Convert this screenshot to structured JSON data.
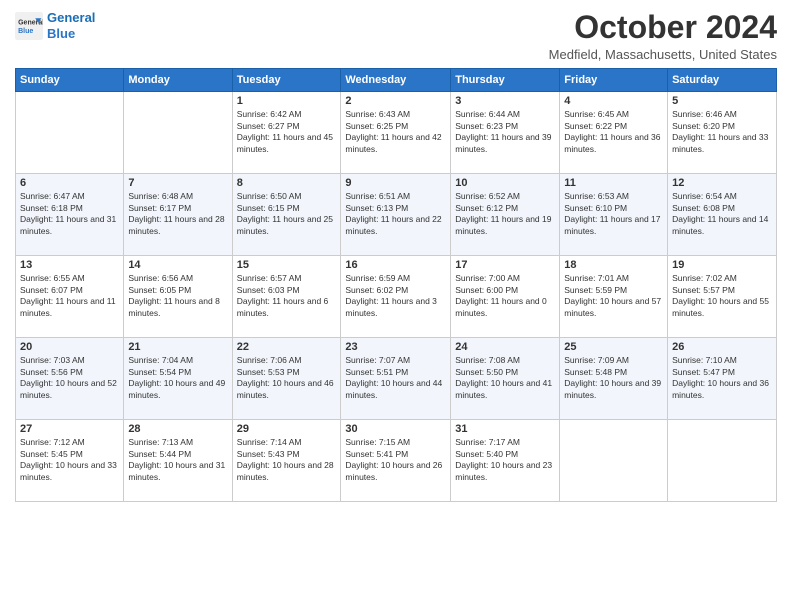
{
  "header": {
    "logo_line1": "General",
    "logo_line2": "Blue",
    "month": "October 2024",
    "location": "Medfield, Massachusetts, United States"
  },
  "weekdays": [
    "Sunday",
    "Monday",
    "Tuesday",
    "Wednesday",
    "Thursday",
    "Friday",
    "Saturday"
  ],
  "weeks": [
    [
      {
        "day": "",
        "sunrise": "",
        "sunset": "",
        "daylight": ""
      },
      {
        "day": "",
        "sunrise": "",
        "sunset": "",
        "daylight": ""
      },
      {
        "day": "1",
        "sunrise": "Sunrise: 6:42 AM",
        "sunset": "Sunset: 6:27 PM",
        "daylight": "Daylight: 11 hours and 45 minutes."
      },
      {
        "day": "2",
        "sunrise": "Sunrise: 6:43 AM",
        "sunset": "Sunset: 6:25 PM",
        "daylight": "Daylight: 11 hours and 42 minutes."
      },
      {
        "day": "3",
        "sunrise": "Sunrise: 6:44 AM",
        "sunset": "Sunset: 6:23 PM",
        "daylight": "Daylight: 11 hours and 39 minutes."
      },
      {
        "day": "4",
        "sunrise": "Sunrise: 6:45 AM",
        "sunset": "Sunset: 6:22 PM",
        "daylight": "Daylight: 11 hours and 36 minutes."
      },
      {
        "day": "5",
        "sunrise": "Sunrise: 6:46 AM",
        "sunset": "Sunset: 6:20 PM",
        "daylight": "Daylight: 11 hours and 33 minutes."
      }
    ],
    [
      {
        "day": "6",
        "sunrise": "Sunrise: 6:47 AM",
        "sunset": "Sunset: 6:18 PM",
        "daylight": "Daylight: 11 hours and 31 minutes."
      },
      {
        "day": "7",
        "sunrise": "Sunrise: 6:48 AM",
        "sunset": "Sunset: 6:17 PM",
        "daylight": "Daylight: 11 hours and 28 minutes."
      },
      {
        "day": "8",
        "sunrise": "Sunrise: 6:50 AM",
        "sunset": "Sunset: 6:15 PM",
        "daylight": "Daylight: 11 hours and 25 minutes."
      },
      {
        "day": "9",
        "sunrise": "Sunrise: 6:51 AM",
        "sunset": "Sunset: 6:13 PM",
        "daylight": "Daylight: 11 hours and 22 minutes."
      },
      {
        "day": "10",
        "sunrise": "Sunrise: 6:52 AM",
        "sunset": "Sunset: 6:12 PM",
        "daylight": "Daylight: 11 hours and 19 minutes."
      },
      {
        "day": "11",
        "sunrise": "Sunrise: 6:53 AM",
        "sunset": "Sunset: 6:10 PM",
        "daylight": "Daylight: 11 hours and 17 minutes."
      },
      {
        "day": "12",
        "sunrise": "Sunrise: 6:54 AM",
        "sunset": "Sunset: 6:08 PM",
        "daylight": "Daylight: 11 hours and 14 minutes."
      }
    ],
    [
      {
        "day": "13",
        "sunrise": "Sunrise: 6:55 AM",
        "sunset": "Sunset: 6:07 PM",
        "daylight": "Daylight: 11 hours and 11 minutes."
      },
      {
        "day": "14",
        "sunrise": "Sunrise: 6:56 AM",
        "sunset": "Sunset: 6:05 PM",
        "daylight": "Daylight: 11 hours and 8 minutes."
      },
      {
        "day": "15",
        "sunrise": "Sunrise: 6:57 AM",
        "sunset": "Sunset: 6:03 PM",
        "daylight": "Daylight: 11 hours and 6 minutes."
      },
      {
        "day": "16",
        "sunrise": "Sunrise: 6:59 AM",
        "sunset": "Sunset: 6:02 PM",
        "daylight": "Daylight: 11 hours and 3 minutes."
      },
      {
        "day": "17",
        "sunrise": "Sunrise: 7:00 AM",
        "sunset": "Sunset: 6:00 PM",
        "daylight": "Daylight: 11 hours and 0 minutes."
      },
      {
        "day": "18",
        "sunrise": "Sunrise: 7:01 AM",
        "sunset": "Sunset: 5:59 PM",
        "daylight": "Daylight: 10 hours and 57 minutes."
      },
      {
        "day": "19",
        "sunrise": "Sunrise: 7:02 AM",
        "sunset": "Sunset: 5:57 PM",
        "daylight": "Daylight: 10 hours and 55 minutes."
      }
    ],
    [
      {
        "day": "20",
        "sunrise": "Sunrise: 7:03 AM",
        "sunset": "Sunset: 5:56 PM",
        "daylight": "Daylight: 10 hours and 52 minutes."
      },
      {
        "day": "21",
        "sunrise": "Sunrise: 7:04 AM",
        "sunset": "Sunset: 5:54 PM",
        "daylight": "Daylight: 10 hours and 49 minutes."
      },
      {
        "day": "22",
        "sunrise": "Sunrise: 7:06 AM",
        "sunset": "Sunset: 5:53 PM",
        "daylight": "Daylight: 10 hours and 46 minutes."
      },
      {
        "day": "23",
        "sunrise": "Sunrise: 7:07 AM",
        "sunset": "Sunset: 5:51 PM",
        "daylight": "Daylight: 10 hours and 44 minutes."
      },
      {
        "day": "24",
        "sunrise": "Sunrise: 7:08 AM",
        "sunset": "Sunset: 5:50 PM",
        "daylight": "Daylight: 10 hours and 41 minutes."
      },
      {
        "day": "25",
        "sunrise": "Sunrise: 7:09 AM",
        "sunset": "Sunset: 5:48 PM",
        "daylight": "Daylight: 10 hours and 39 minutes."
      },
      {
        "day": "26",
        "sunrise": "Sunrise: 7:10 AM",
        "sunset": "Sunset: 5:47 PM",
        "daylight": "Daylight: 10 hours and 36 minutes."
      }
    ],
    [
      {
        "day": "27",
        "sunrise": "Sunrise: 7:12 AM",
        "sunset": "Sunset: 5:45 PM",
        "daylight": "Daylight: 10 hours and 33 minutes."
      },
      {
        "day": "28",
        "sunrise": "Sunrise: 7:13 AM",
        "sunset": "Sunset: 5:44 PM",
        "daylight": "Daylight: 10 hours and 31 minutes."
      },
      {
        "day": "29",
        "sunrise": "Sunrise: 7:14 AM",
        "sunset": "Sunset: 5:43 PM",
        "daylight": "Daylight: 10 hours and 28 minutes."
      },
      {
        "day": "30",
        "sunrise": "Sunrise: 7:15 AM",
        "sunset": "Sunset: 5:41 PM",
        "daylight": "Daylight: 10 hours and 26 minutes."
      },
      {
        "day": "31",
        "sunrise": "Sunrise: 7:17 AM",
        "sunset": "Sunset: 5:40 PM",
        "daylight": "Daylight: 10 hours and 23 minutes."
      },
      {
        "day": "",
        "sunrise": "",
        "sunset": "",
        "daylight": ""
      },
      {
        "day": "",
        "sunrise": "",
        "sunset": "",
        "daylight": ""
      }
    ]
  ]
}
